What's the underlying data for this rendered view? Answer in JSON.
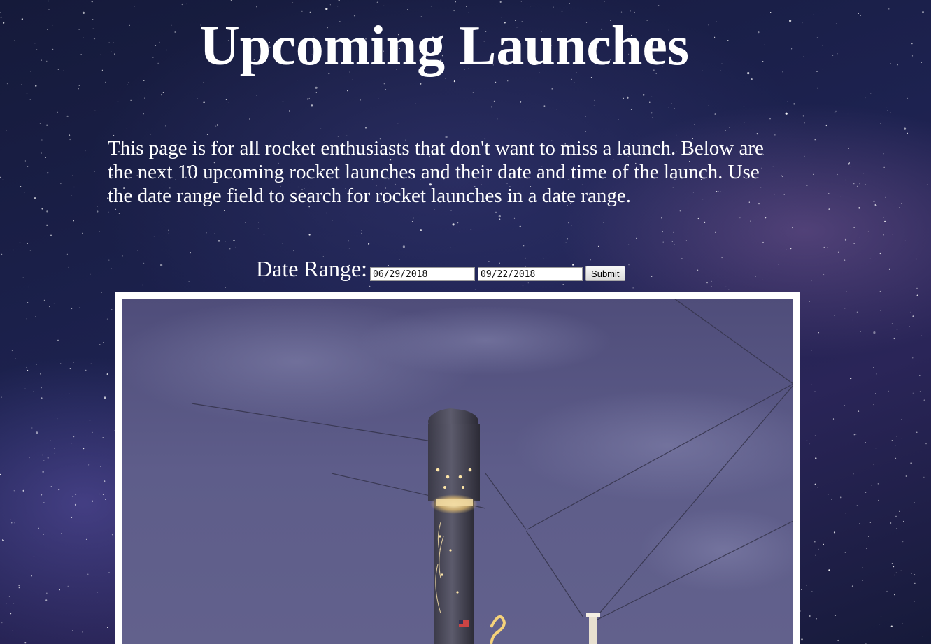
{
  "page": {
    "title": "Upcoming Launches",
    "intro": "This page is for all rocket enthusiasts that don't want to miss a launch. Below are the next 10 upcoming rocket launches and their date and time of the launch. Use the date range field to search for rocket launches in a date range."
  },
  "date_range": {
    "label": "Date Range:",
    "start_value": "06/29/2018",
    "end_value": "09/22/2018",
    "submit_label": "Submit"
  },
  "hero_image": {
    "subject": "rocket-on-launch-pad"
  },
  "colors": {
    "background": "#1d2250",
    "text": "#ffffff",
    "frame": "#ffffff",
    "sky": "#5a5a86"
  }
}
